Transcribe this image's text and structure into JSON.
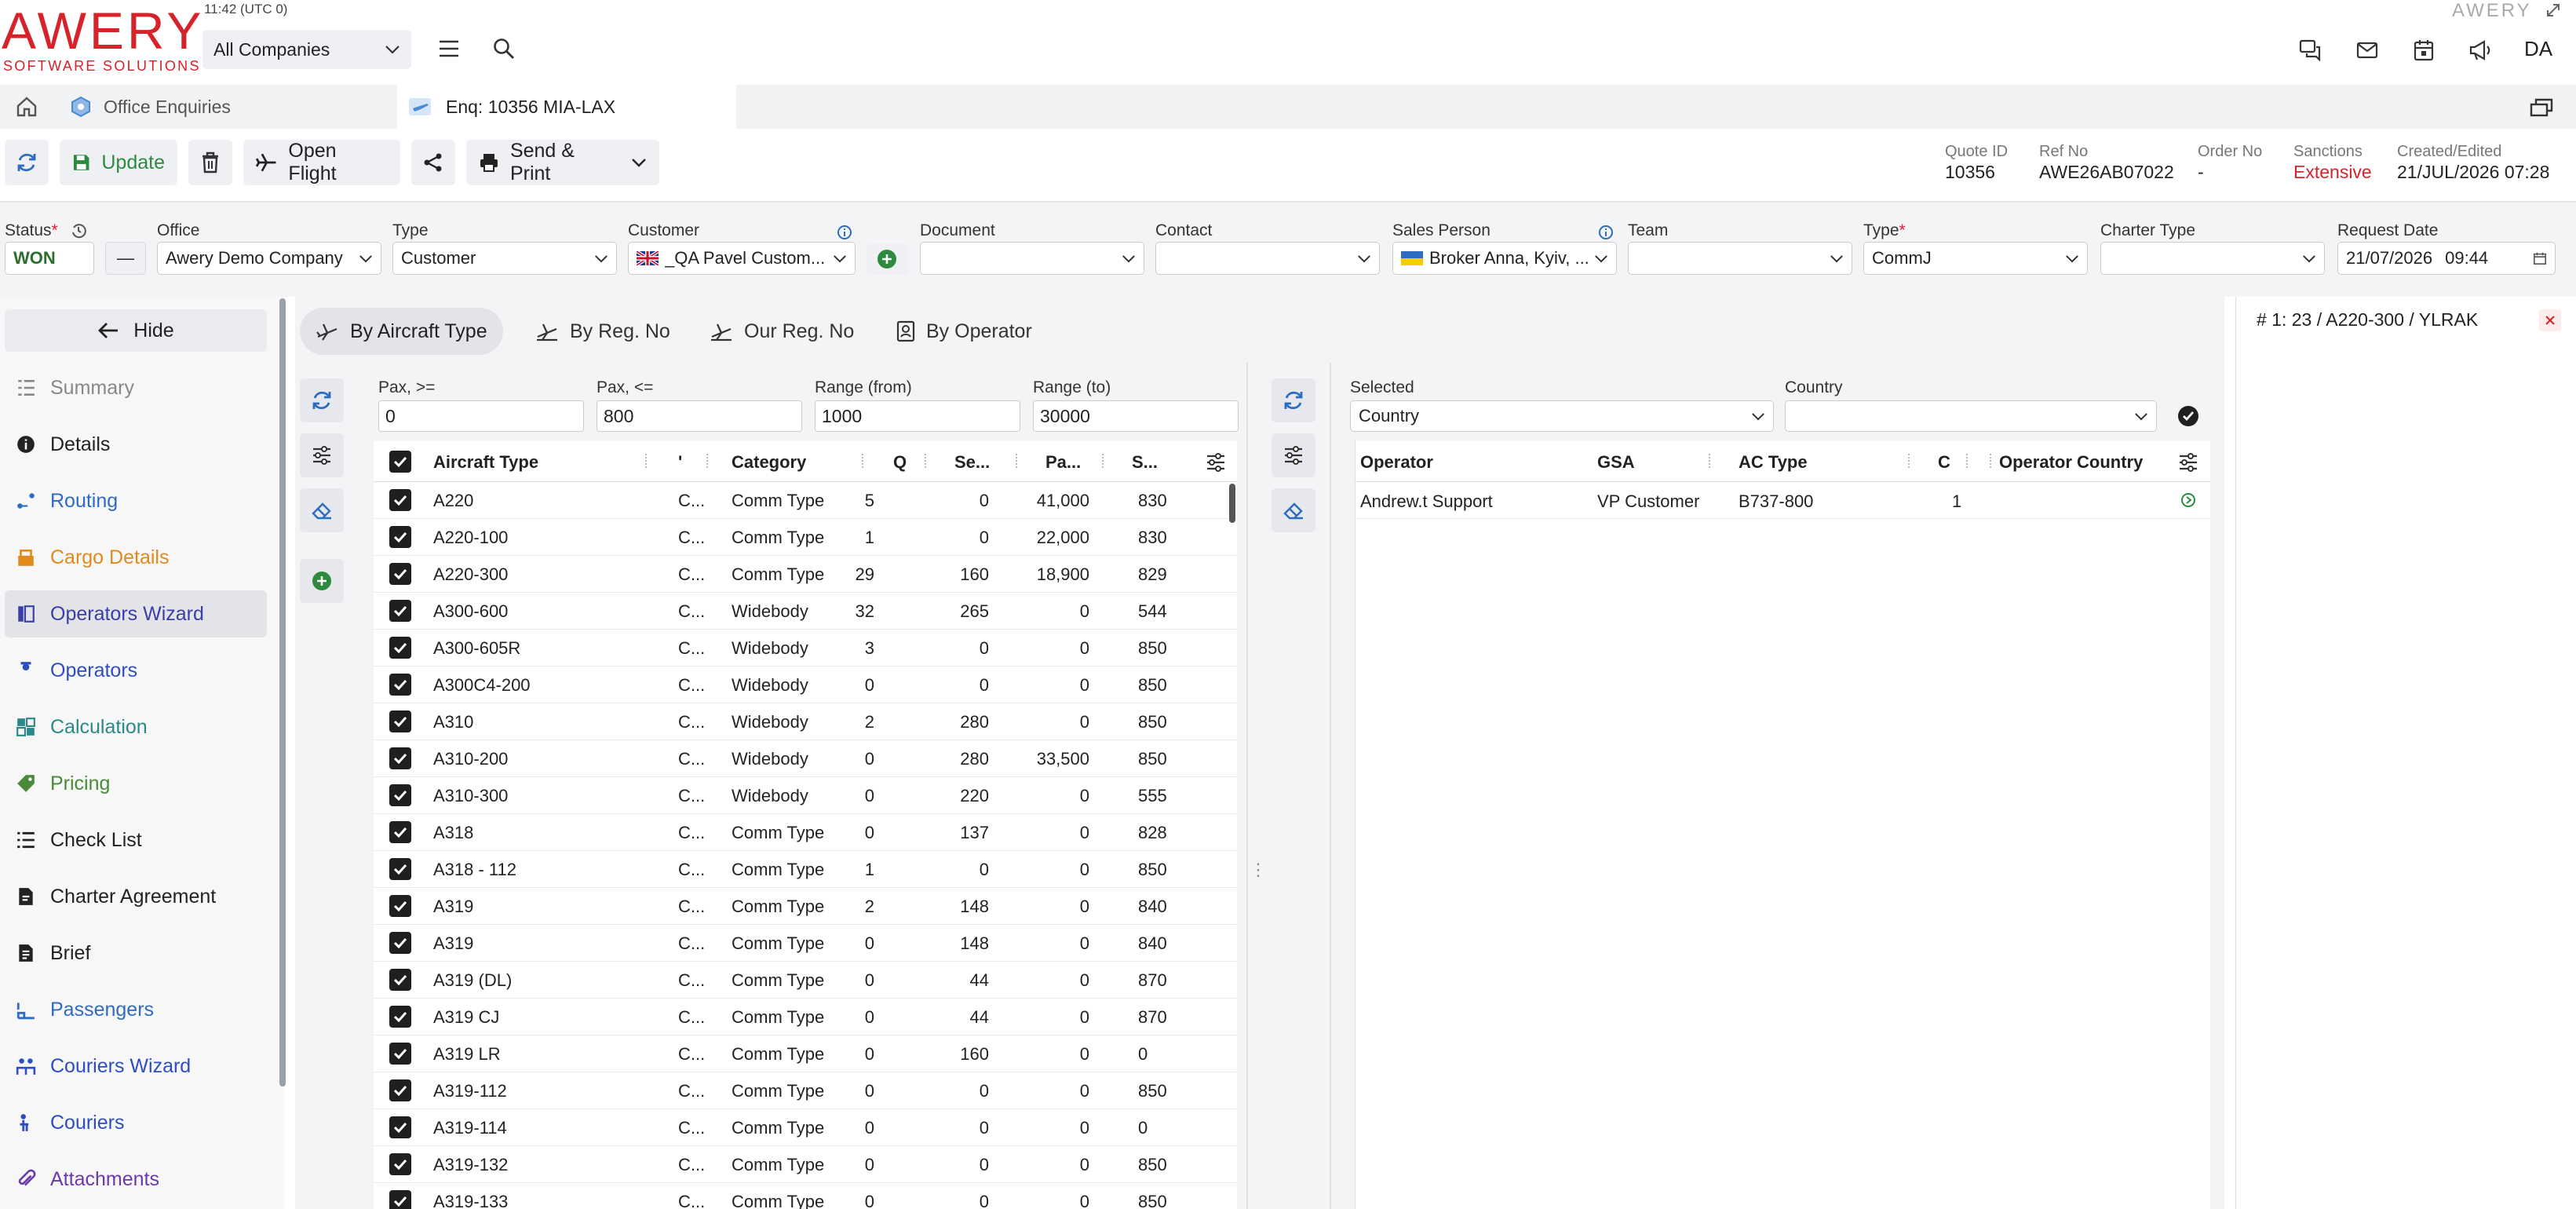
{
  "brand": {
    "logo": "AWERY",
    "tagline": "SOFTWARE SOLUTIONS",
    "corner_logo": "AWERY"
  },
  "clock": "11:42 (UTC 0)",
  "company_select": "All Companies",
  "user_initials": "DA",
  "tabs": {
    "office": "Office Enquiries",
    "enquiry": "Enq: 10356 MIA-LAX"
  },
  "toolbar": {
    "update": "Update",
    "open_flight": "Open Flight",
    "send_print": "Send & Print"
  },
  "meta": [
    {
      "label": "Quote ID",
      "value": "10356"
    },
    {
      "label": "Ref No",
      "value": "AWE26AB07022"
    },
    {
      "label": "Order No",
      "value": "-"
    },
    {
      "label": "Sanctions",
      "value": "Extensive"
    },
    {
      "label": "Created/Edited",
      "value": "21/JUL/2026 07:28"
    }
  ],
  "filters": {
    "status_label": "Status",
    "status_value": "WON",
    "status_dash": "—",
    "office_label": "Office",
    "office_value": "Awery Demo Company",
    "type_label": "Type",
    "type_value": "Customer",
    "customer_label": "Customer",
    "customer_value": "_QA Pavel Custom...",
    "document_label": "Document",
    "document_value": "",
    "contact_label": "Contact",
    "contact_value": "",
    "sales_label": "Sales Person",
    "sales_value": "Broker Anna, Kyiv, ...",
    "team_label": "Team",
    "team_value": "",
    "type2_label": "Type",
    "type2_value": "CommJ",
    "charter_label": "Charter Type",
    "charter_value": "",
    "request_label": "Request Date",
    "request_date": "21/07/2026",
    "request_time": "09:44"
  },
  "sidebar": {
    "hide": "Hide",
    "items": [
      {
        "label": "Summary",
        "color": "#888888"
      },
      {
        "label": "Details",
        "color": "#222222"
      },
      {
        "label": "Routing",
        "color": "#2d6cc0"
      },
      {
        "label": "Cargo Details",
        "color": "#e08a1e"
      },
      {
        "label": "Operators Wizard",
        "color": "#3a3fa8"
      },
      {
        "label": "Operators",
        "color": "#2d4ec0"
      },
      {
        "label": "Calculation",
        "color": "#2a8a8a"
      },
      {
        "label": "Pricing",
        "color": "#4a8a3a"
      },
      {
        "label": "Check List",
        "color": "#222222"
      },
      {
        "label": "Charter Agreement",
        "color": "#222222"
      },
      {
        "label": "Brief",
        "color": "#222222"
      },
      {
        "label": "Passengers",
        "color": "#2d6cc0"
      },
      {
        "label": "Couriers Wizard",
        "color": "#2d4ec0"
      },
      {
        "label": "Couriers",
        "color": "#2d4ec0"
      },
      {
        "label": "Attachments",
        "color": "#6a3aa8"
      }
    ]
  },
  "search_modes": {
    "aircraft": "By Aircraft Type",
    "reg": "By Reg. No",
    "our_reg": "Our Reg. No",
    "operator": "By Operator"
  },
  "params": {
    "pax_min_label": "Pax, >=",
    "pax_min": "0",
    "pax_max_label": "Pax, <=",
    "pax_max": "800",
    "range_from_label": "Range (from)",
    "range_from": "1000",
    "range_to_label": "Range (to)",
    "range_to": "30000"
  },
  "aircraft_grid": {
    "headers": {
      "type": "Aircraft Type",
      "t": "'",
      "category": "Category",
      "q": "Q",
      "se": "Se...",
      "pa": "Pa...",
      "s": "S..."
    },
    "rows": [
      {
        "type": "A220",
        "t": "C...",
        "category": "Comm Type",
        "q": "5",
        "se": "0",
        "pa": "41,000",
        "s": "830"
      },
      {
        "type": "A220-100",
        "t": "C...",
        "category": "Comm Type",
        "q": "1",
        "se": "0",
        "pa": "22,000",
        "s": "830"
      },
      {
        "type": "A220-300",
        "t": "C...",
        "category": "Comm Type",
        "q": "29",
        "se": "160",
        "pa": "18,900",
        "s": "829"
      },
      {
        "type": "A300-600",
        "t": "C...",
        "category": "Widebody",
        "q": "32",
        "se": "265",
        "pa": "0",
        "s": "544"
      },
      {
        "type": "A300-605R",
        "t": "C...",
        "category": "Widebody",
        "q": "3",
        "se": "0",
        "pa": "0",
        "s": "850"
      },
      {
        "type": "A300C4-200",
        "t": "C...",
        "category": "Widebody",
        "q": "0",
        "se": "0",
        "pa": "0",
        "s": "850"
      },
      {
        "type": "A310",
        "t": "C...",
        "category": "Widebody",
        "q": "2",
        "se": "280",
        "pa": "0",
        "s": "850"
      },
      {
        "type": "A310-200",
        "t": "C...",
        "category": "Widebody",
        "q": "0",
        "se": "280",
        "pa": "33,500",
        "s": "850"
      },
      {
        "type": "A310-300",
        "t": "C...",
        "category": "Widebody",
        "q": "0",
        "se": "220",
        "pa": "0",
        "s": "555"
      },
      {
        "type": "A318",
        "t": "C...",
        "category": "Comm Type",
        "q": "0",
        "se": "137",
        "pa": "0",
        "s": "828"
      },
      {
        "type": "A318 - 112",
        "t": "C...",
        "category": "Comm Type",
        "q": "1",
        "se": "0",
        "pa": "0",
        "s": "850"
      },
      {
        "type": "A319",
        "t": "C...",
        "category": "Comm Type",
        "q": "2",
        "se": "148",
        "pa": "0",
        "s": "840"
      },
      {
        "type": "A319",
        "t": "C...",
        "category": "Comm Type",
        "q": "0",
        "se": "148",
        "pa": "0",
        "s": "840"
      },
      {
        "type": "A319 (DL)",
        "t": "C...",
        "category": "Comm Type",
        "q": "0",
        "se": "44",
        "pa": "0",
        "s": "870"
      },
      {
        "type": "A319 CJ",
        "t": "C...",
        "category": "Comm Type",
        "q": "0",
        "se": "44",
        "pa": "0",
        "s": "870"
      },
      {
        "type": "A319 LR",
        "t": "C...",
        "category": "Comm Type",
        "q": "0",
        "se": "160",
        "pa": "0",
        "s": "0"
      },
      {
        "type": "A319-112",
        "t": "C...",
        "category": "Comm Type",
        "q": "0",
        "se": "0",
        "pa": "0",
        "s": "850"
      },
      {
        "type": "A319-114",
        "t": "C...",
        "category": "Comm Type",
        "q": "0",
        "se": "0",
        "pa": "0",
        "s": "0"
      },
      {
        "type": "A319-132",
        "t": "C...",
        "category": "Comm Type",
        "q": "0",
        "se": "0",
        "pa": "0",
        "s": "850"
      },
      {
        "type": "A319-133",
        "t": "C...",
        "category": "Comm Type",
        "q": "0",
        "se": "0",
        "pa": "0",
        "s": "850"
      }
    ]
  },
  "operator_filter": {
    "selected_label": "Selected",
    "selected_value": "Country",
    "country_label": "Country",
    "country_value": ""
  },
  "operator_grid": {
    "headers": {
      "operator": "Operator",
      "gsa": "GSA",
      "ac_type": "AC Type",
      "c": "C",
      "country": "Operator Country"
    },
    "rows": [
      {
        "operator": "Andrew.t Support",
        "gsa": "VP Customer",
        "ac_type": "B737-800",
        "c": "1",
        "country": ""
      }
    ]
  },
  "right_panel": {
    "title": "# 1: 23 / A220-300 / YLRAK"
  }
}
